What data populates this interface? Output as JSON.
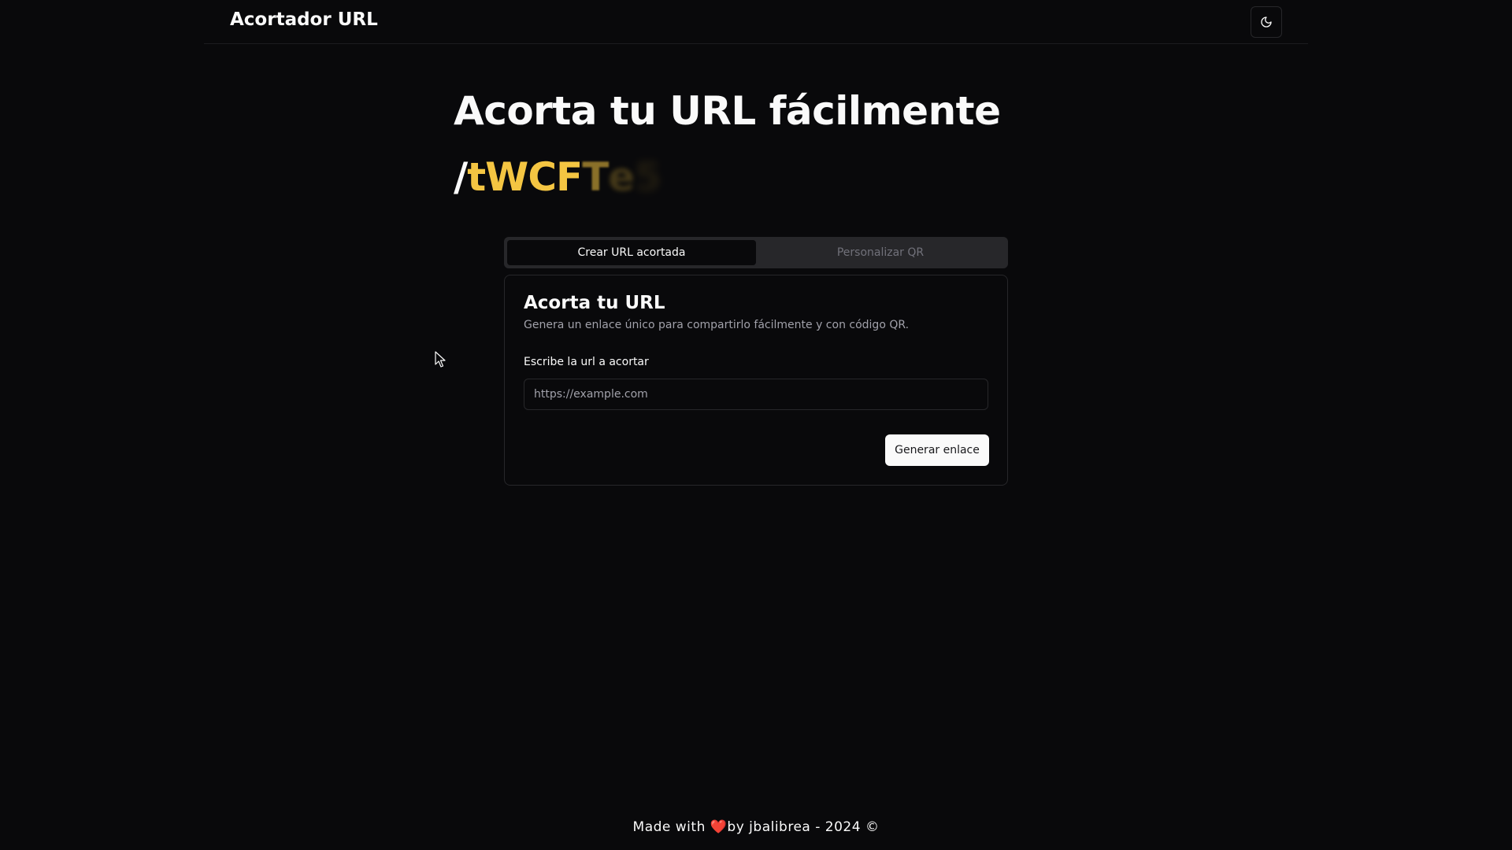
{
  "header": {
    "brand": "Acortador URL",
    "theme_toggle_icon": "moon-icon"
  },
  "hero": {
    "title": "Acorta tu URL fácilmente",
    "slug_prefix": "/",
    "slug_chars": [
      "t",
      "W",
      "C",
      "F",
      "T",
      "e",
      "5"
    ]
  },
  "tabs": [
    {
      "label": "Crear URL acortada",
      "active": true
    },
    {
      "label": "Personalizar QR",
      "active": false
    }
  ],
  "card": {
    "title": "Acorta tu URL",
    "description": "Genera un enlace único para compartirlo fácilmente y con código QR.",
    "field_label": "Escribe la url a acortar",
    "input_value": "",
    "input_placeholder": "https://example.com",
    "submit_label": "Generar enlace"
  },
  "footer": {
    "prefix": "Made with ",
    "heart": "❤️",
    "suffix": "by jbalibrea - 2024 ©"
  },
  "colors": {
    "background": "#09090b",
    "accent": "#f4c542",
    "border": "#27272a",
    "muted": "#a1a1aa",
    "heart": "#ef4444"
  }
}
